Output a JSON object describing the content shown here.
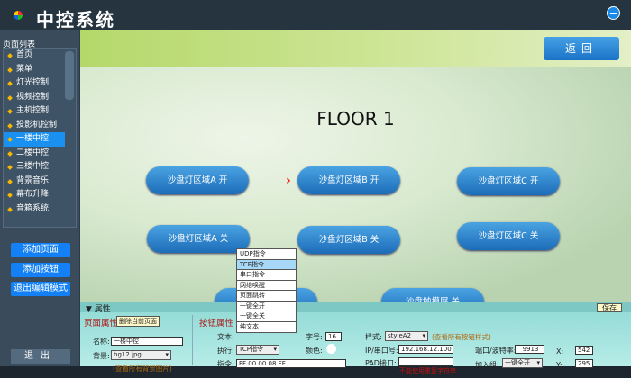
{
  "header": {
    "title": "中控系统"
  },
  "sidebar": {
    "label": "页面列表",
    "items": [
      "首页",
      "菜单",
      "灯光控制",
      "视频控制",
      "主机控制",
      "投影机控制",
      "一楼中控",
      "二楼中控",
      "三楼中控",
      "背景音乐",
      "幕布升降",
      "音箱系统"
    ],
    "selected": "一楼中控",
    "buttons": {
      "add_page": "添加页面",
      "add_button": "添加按钮",
      "exit_edit": "退出编辑模式",
      "exit": "退出"
    }
  },
  "main": {
    "back": "返回",
    "floor_title": "FLOOR 1",
    "buttons": [
      "沙盘灯区域A 开",
      "沙盘灯区域B 开",
      "沙盘灯区域C 开",
      "沙盘灯区域A 关",
      "沙盘灯区域B 关",
      "沙盘灯区域C 关",
      "沙盘触摸屏 关"
    ]
  },
  "dropdown": {
    "options": [
      "UDP指令",
      "TCP指令",
      "串口指令",
      "网络唤醒",
      "页面跳转",
      "一键全开",
      "一键全关",
      "纯文本"
    ],
    "selected": "TCP指令"
  },
  "props": {
    "header": "属性",
    "save": "保存",
    "page_props": "页面属性",
    "delete_page": "删除当前页面",
    "name_label": "名称:",
    "name_value": "一楼中控",
    "bg_label": "背景:",
    "bg_value": "bg12.jpg",
    "view_bg": "(查看所有背景图片)",
    "button_props": "按钮属性",
    "text_label": "文本:",
    "exec_label": "执行:",
    "exec_value": "TCP指令",
    "cmd_label": "指令:",
    "cmd_value": "FF 00 00 08 FF",
    "font_label": "字号:",
    "font_value": "16",
    "color_label": "颜色:",
    "style_label": "样式:",
    "style_value": "styleA2",
    "view_styles": "(查看所有按钮样式)",
    "ip_label": "IP/串口号:",
    "ip_value": "192.168.12.100",
    "pad_label": "PAD接口:",
    "pad_value": "",
    "pad_warn": "不能使用重复字符串",
    "port_label": "端口/波特率:",
    "port_value": "9913",
    "group_label": "加入组:",
    "group_value": "一键全开",
    "x_label": "X:",
    "x_value": "542",
    "y_label": "Y:",
    "y_value": "295"
  }
}
